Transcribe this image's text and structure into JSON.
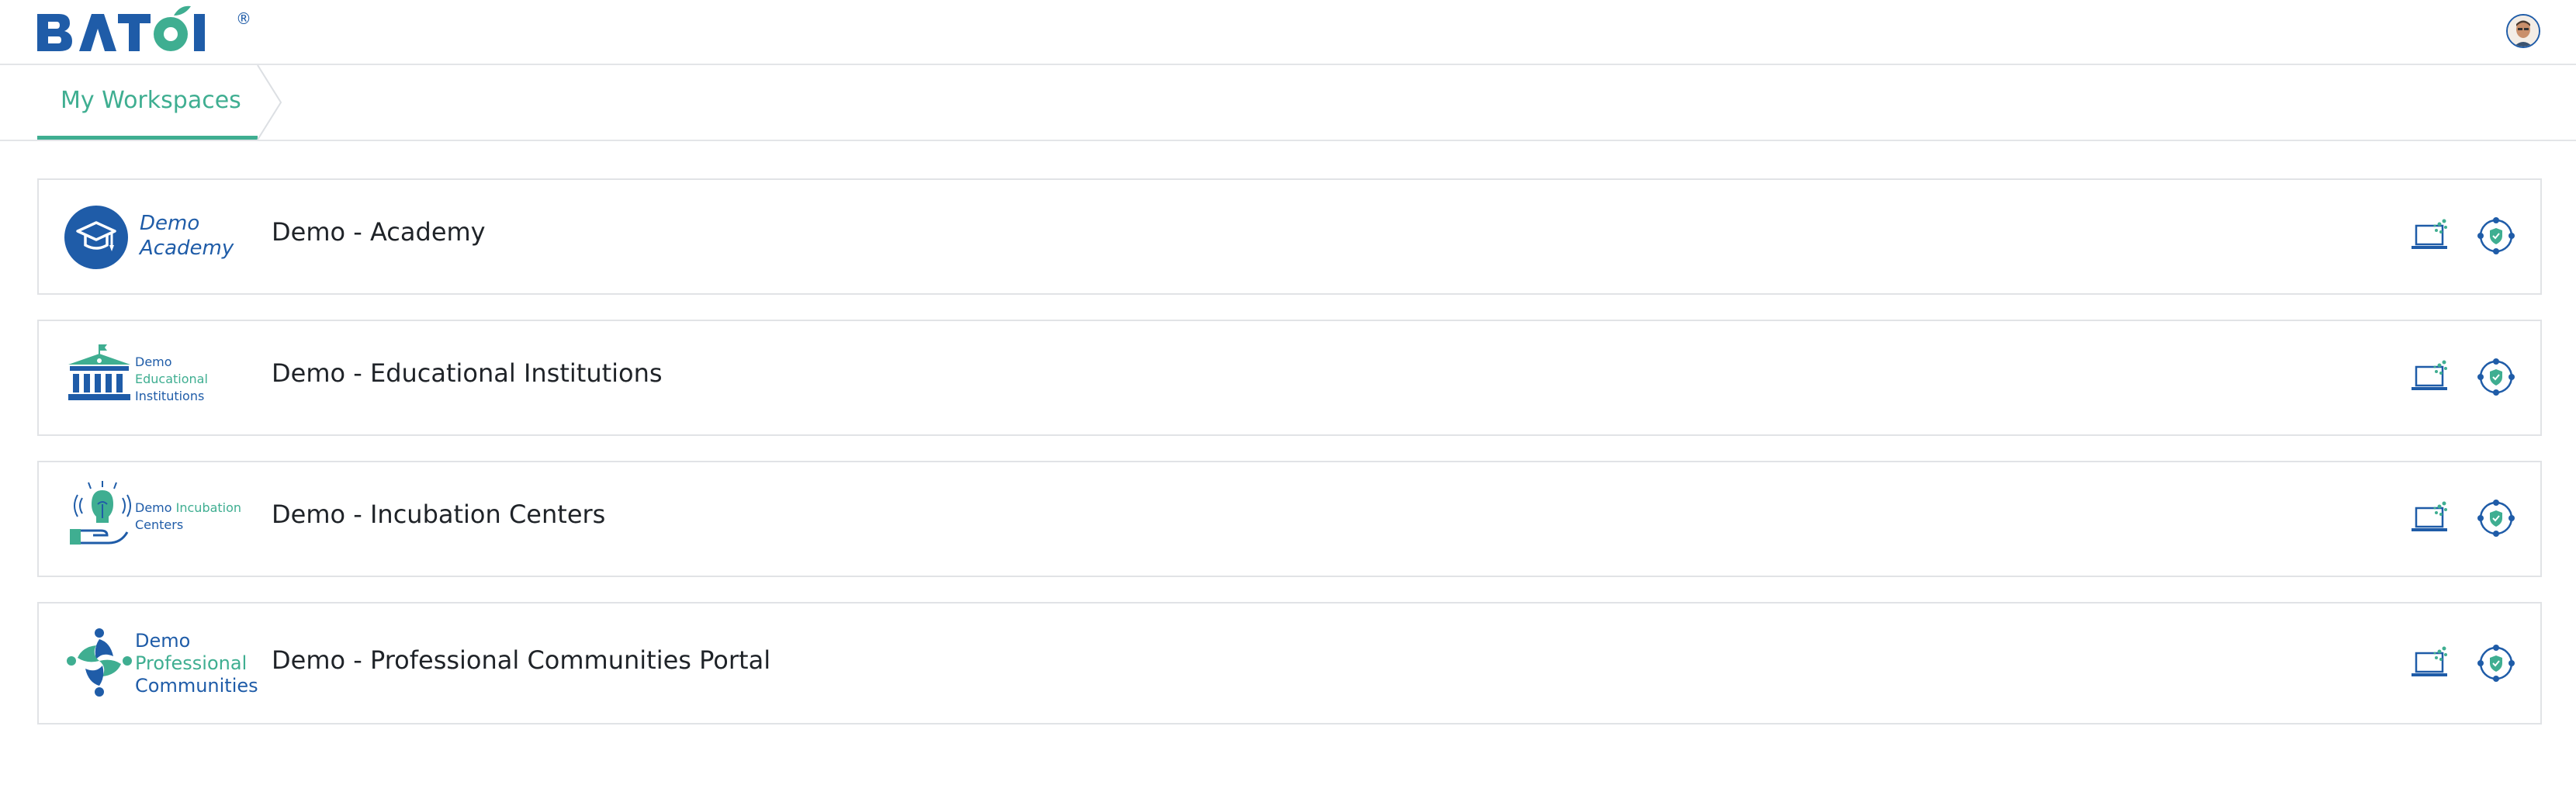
{
  "header": {
    "brand": "BATOI",
    "brand_mark": "®",
    "avatar_icon": "user-avatar"
  },
  "breadcrumb": {
    "items": [
      {
        "label": "My Workspaces"
      }
    ]
  },
  "colors": {
    "brand_blue": "#1f5ca8",
    "accent_green": "#3fae91",
    "border": "#e1e3e6",
    "text": "#1f2328"
  },
  "workspaces": [
    {
      "title": "Demo - Academy",
      "logo_lines": [
        "Demo",
        "Academy"
      ],
      "logo_icon": "graduation-cap-icon",
      "actions": [
        "laptop-launch-icon",
        "secure-network-icon"
      ]
    },
    {
      "title": "Demo - Educational Institutions",
      "logo_lines": [
        "Demo",
        "Educational",
        "Institutions"
      ],
      "logo_icon": "institution-building-icon",
      "actions": [
        "laptop-launch-icon",
        "secure-network-icon"
      ]
    },
    {
      "title": "Demo - Incubation Centers",
      "logo_lines": [
        "Demo",
        "Incubation",
        "Centers"
      ],
      "logo_icon": "lightbulb-hand-icon",
      "actions": [
        "laptop-launch-icon",
        "secure-network-icon"
      ]
    },
    {
      "title": "Demo - Professional Communities Portal",
      "logo_lines": [
        "Demo",
        "Professional",
        "Communities"
      ],
      "logo_icon": "people-pinwheel-icon",
      "actions": [
        "laptop-launch-icon",
        "secure-network-icon"
      ]
    }
  ]
}
